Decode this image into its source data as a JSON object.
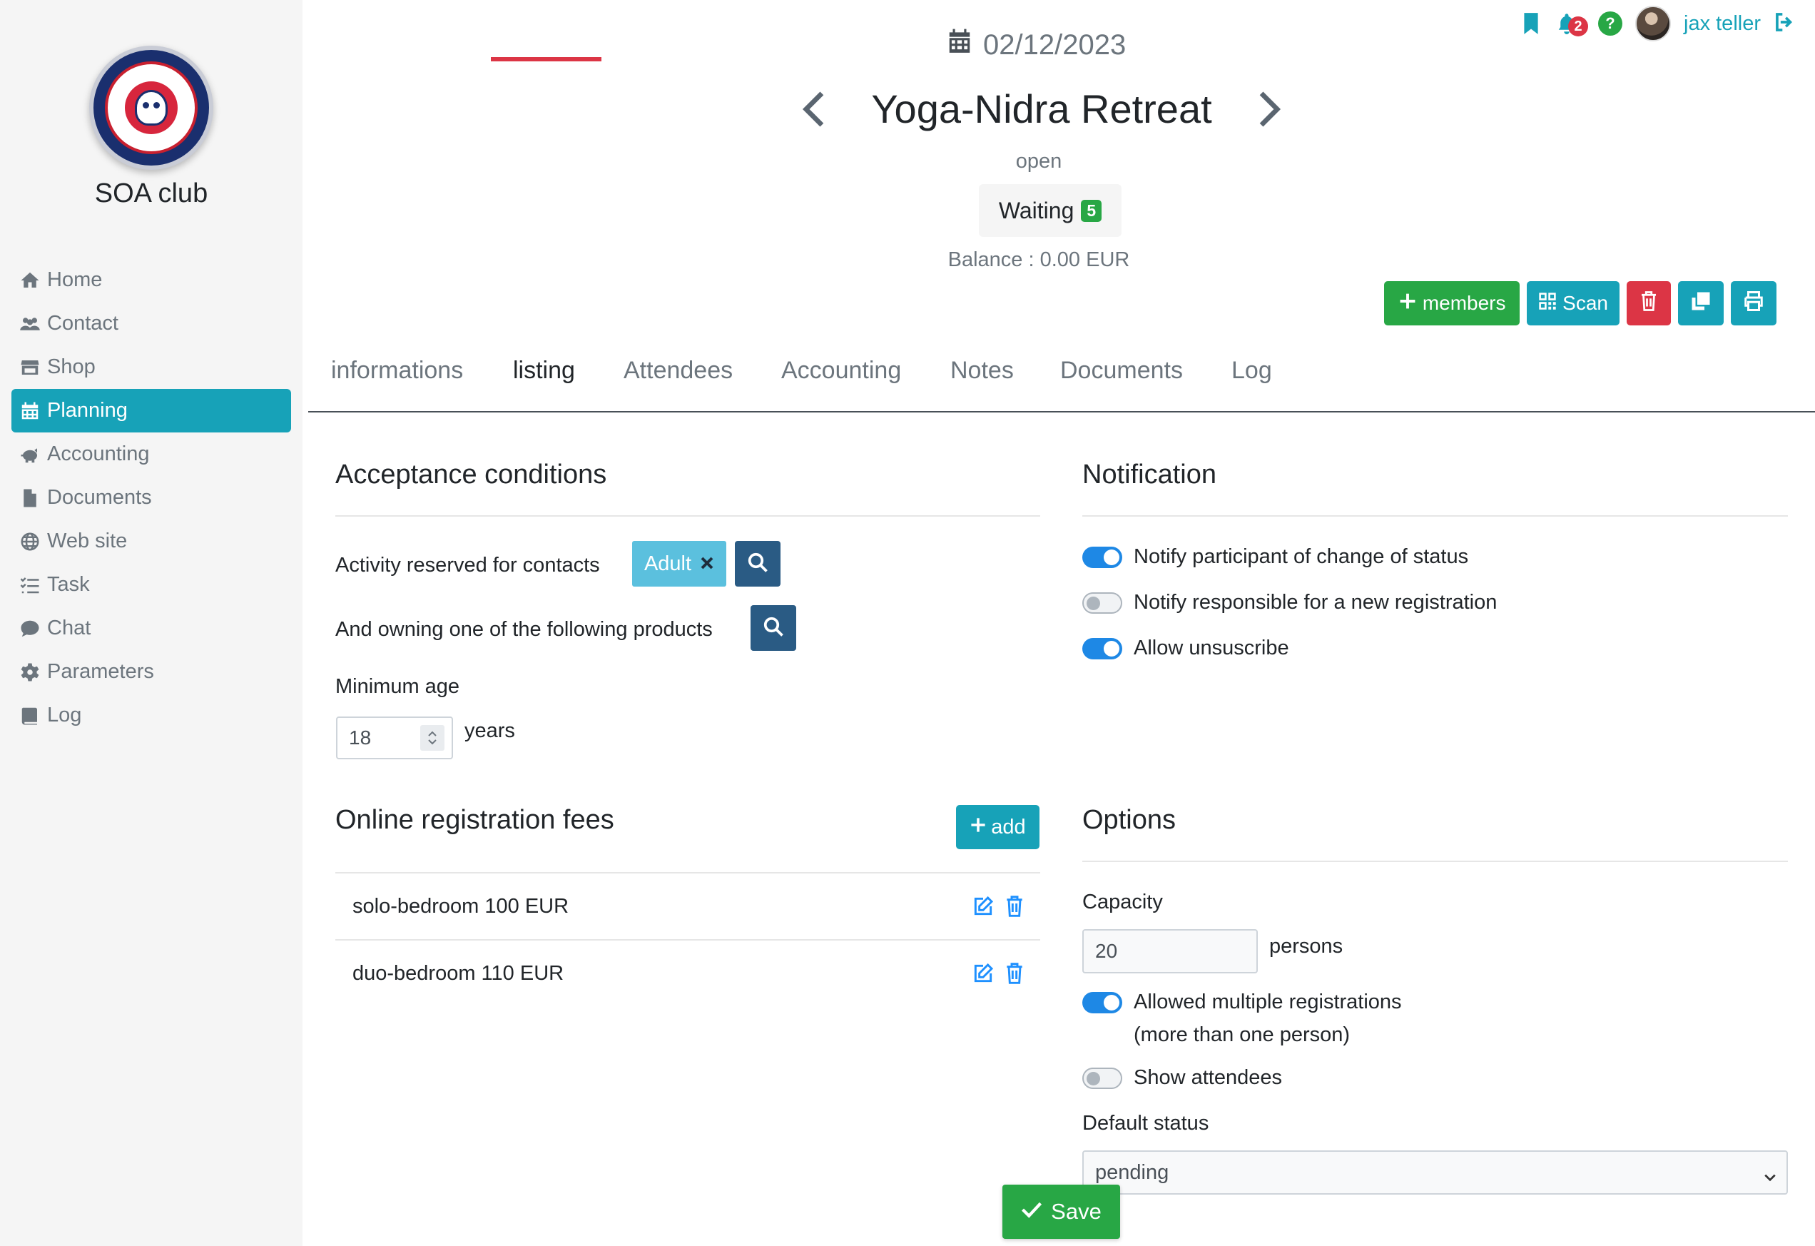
{
  "sidebar": {
    "club_name": "SOA club",
    "items": [
      {
        "label": "Home",
        "icon": "home-icon"
      },
      {
        "label": "Contact",
        "icon": "users-icon"
      },
      {
        "label": "Shop",
        "icon": "store-icon"
      },
      {
        "label": "Planning",
        "icon": "calendar-icon",
        "active": true
      },
      {
        "label": "Accounting",
        "icon": "piggy-bank-icon"
      },
      {
        "label": "Documents",
        "icon": "file-icon"
      },
      {
        "label": "Web site",
        "icon": "globe-icon"
      },
      {
        "label": "Task",
        "icon": "tasks-icon"
      },
      {
        "label": "Chat",
        "icon": "comment-icon"
      },
      {
        "label": "Parameters",
        "icon": "gear-icon"
      },
      {
        "label": "Log",
        "icon": "book-icon"
      }
    ]
  },
  "topbar": {
    "notification_count": "2",
    "help": "?",
    "user_name": "jax teller"
  },
  "header": {
    "date": "02/12/2023",
    "title": "Yoga-Nidra Retreat",
    "status": "open",
    "waiting_label": "Waiting",
    "waiting_count": "5",
    "balance": "Balance : 0.00 EUR"
  },
  "actions": {
    "members_label": "members",
    "scan_label": "Scan"
  },
  "tabs": [
    "informations",
    "listing",
    "Attendees",
    "Accounting",
    "Notes",
    "Documents",
    "Log"
  ],
  "active_tab": "listing",
  "acceptance": {
    "title": "Acceptance conditions",
    "reserved_label": "Activity reserved for contacts",
    "tag": "Adult",
    "products_label": "And owning one of the following products",
    "min_age_label": "Minimum age",
    "min_age_value": "18",
    "years_label": "years"
  },
  "fees": {
    "title": "Online registration fees",
    "add_label": "add",
    "rows": [
      "solo-bedroom 100 EUR",
      "duo-bedroom 110 EUR"
    ]
  },
  "notification": {
    "title": "Notification",
    "items": [
      {
        "label": "Notify participant of change of status",
        "on": true
      },
      {
        "label": "Notify responsible for a new registration",
        "on": false
      },
      {
        "label": "Allow unsuscribe",
        "on": true
      }
    ]
  },
  "options": {
    "title": "Options",
    "capacity_label": "Capacity",
    "capacity_value": "20",
    "persons_label": "persons",
    "multiple_label": "Allowed multiple registrations",
    "multiple_sub": "(more than one person)",
    "multiple_on": true,
    "show_attendees_label": "Show attendees",
    "show_attendees_on": false,
    "default_status_label": "Default status",
    "default_status_value": "pending"
  },
  "save_label": "Save",
  "colors": {
    "primary": "#17a2b8",
    "success": "#28a745",
    "danger": "#dc3545",
    "toggle_on": "#1e88e5",
    "dark_button": "#2a5b84"
  }
}
